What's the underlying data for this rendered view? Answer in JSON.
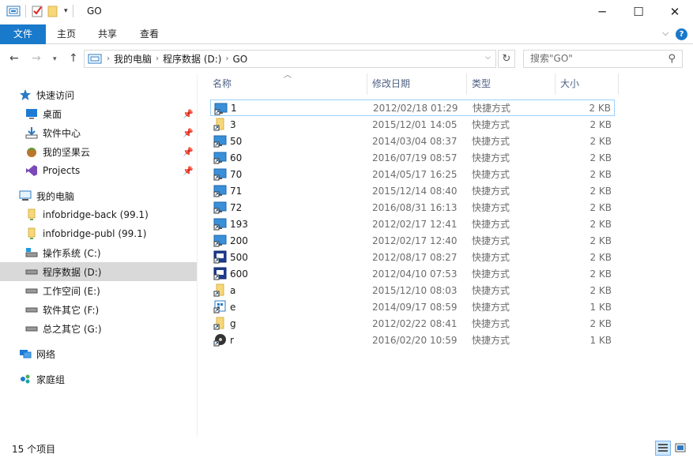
{
  "window": {
    "title": "GO",
    "controls": {
      "minimize": "─",
      "maximize": "☐",
      "close": "✕"
    }
  },
  "ribbon": {
    "tabs": [
      "文件",
      "主页",
      "共享",
      "查看"
    ],
    "collapse_icon": "chevron-down-icon",
    "help_label": "?"
  },
  "address": {
    "crumbs": [
      "我的电脑",
      "程序数据 (D:)",
      "GO"
    ],
    "search_placeholder": "搜索\"GO\""
  },
  "nav": {
    "quick_access": "快速访问",
    "pinned": [
      {
        "label": "桌面",
        "icon": "desktop-icon",
        "pinned": true
      },
      {
        "label": "软件中心",
        "icon": "download-icon",
        "pinned": true
      },
      {
        "label": "我的坚果云",
        "icon": "nutstore-icon",
        "pinned": true
      },
      {
        "label": "Projects",
        "icon": "visual-studio-icon",
        "pinned": true
      }
    ],
    "this_pc": "我的电脑",
    "drives": [
      {
        "label": "infobridge-back (99.1)",
        "icon": "network-drive-icon",
        "selected": false
      },
      {
        "label": "infobridge-publ (99.1)",
        "icon": "network-drive-icon",
        "selected": false
      },
      {
        "label": "操作系统 (C:)",
        "icon": "system-drive-icon",
        "selected": false
      },
      {
        "label": "程序数据 (D:)",
        "icon": "drive-icon",
        "selected": true
      },
      {
        "label": "工作空间 (E:)",
        "icon": "drive-icon",
        "selected": false
      },
      {
        "label": "软件其它 (F:)",
        "icon": "drive-icon",
        "selected": false
      },
      {
        "label": "总之其它 (G:)",
        "icon": "drive-icon",
        "selected": false
      }
    ],
    "network": "网络",
    "homegroup": "家庭组"
  },
  "columns": {
    "name": "名称",
    "date": "修改日期",
    "type": "类型",
    "size": "大小"
  },
  "files": [
    {
      "name": "1",
      "date": "2012/02/18 01:29",
      "type": "快捷方式",
      "size": "2 KB",
      "icon": "shortcut-monitor-icon",
      "focused": true
    },
    {
      "name": "3",
      "date": "2015/12/01 14:05",
      "type": "快捷方式",
      "size": "2 KB",
      "icon": "shortcut-folder-icon"
    },
    {
      "name": "50",
      "date": "2014/03/04 08:37",
      "type": "快捷方式",
      "size": "2 KB",
      "icon": "shortcut-monitor-icon"
    },
    {
      "name": "60",
      "date": "2016/07/19 08:57",
      "type": "快捷方式",
      "size": "2 KB",
      "icon": "shortcut-monitor-icon"
    },
    {
      "name": "70",
      "date": "2014/05/17 16:25",
      "type": "快捷方式",
      "size": "2 KB",
      "icon": "shortcut-monitor-icon"
    },
    {
      "name": "71",
      "date": "2015/12/14 08:40",
      "type": "快捷方式",
      "size": "2 KB",
      "icon": "shortcut-monitor-icon"
    },
    {
      "name": "72",
      "date": "2016/08/31 16:13",
      "type": "快捷方式",
      "size": "2 KB",
      "icon": "shortcut-monitor-icon"
    },
    {
      "name": "193",
      "date": "2012/02/17 12:41",
      "type": "快捷方式",
      "size": "2 KB",
      "icon": "shortcut-monitor-icon"
    },
    {
      "name": "200",
      "date": "2012/02/17 12:40",
      "type": "快捷方式",
      "size": "2 KB",
      "icon": "shortcut-monitor-icon"
    },
    {
      "name": "500",
      "date": "2012/08/17 08:27",
      "type": "快捷方式",
      "size": "2 KB",
      "icon": "shortcut-remote-icon"
    },
    {
      "name": "600",
      "date": "2012/04/10 07:53",
      "type": "快捷方式",
      "size": "2 KB",
      "icon": "shortcut-remote-icon"
    },
    {
      "name": "a",
      "date": "2015/12/10 08:03",
      "type": "快捷方式",
      "size": "2 KB",
      "icon": "shortcut-folder-icon"
    },
    {
      "name": "e",
      "date": "2014/09/17 08:59",
      "type": "快捷方式",
      "size": "1 KB",
      "icon": "shortcut-app-icon"
    },
    {
      "name": "g",
      "date": "2012/02/22 08:41",
      "type": "快捷方式",
      "size": "2 KB",
      "icon": "shortcut-folder-icon"
    },
    {
      "name": "r",
      "date": "2016/02/20 10:59",
      "type": "快捷方式",
      "size": "1 KB",
      "icon": "shortcut-disc-icon"
    }
  ],
  "status": {
    "item_count": "15 个项目"
  },
  "colors": {
    "accent": "#1979ca",
    "selected_nav": "#d9d9d9",
    "header_text": "#4d6082"
  }
}
